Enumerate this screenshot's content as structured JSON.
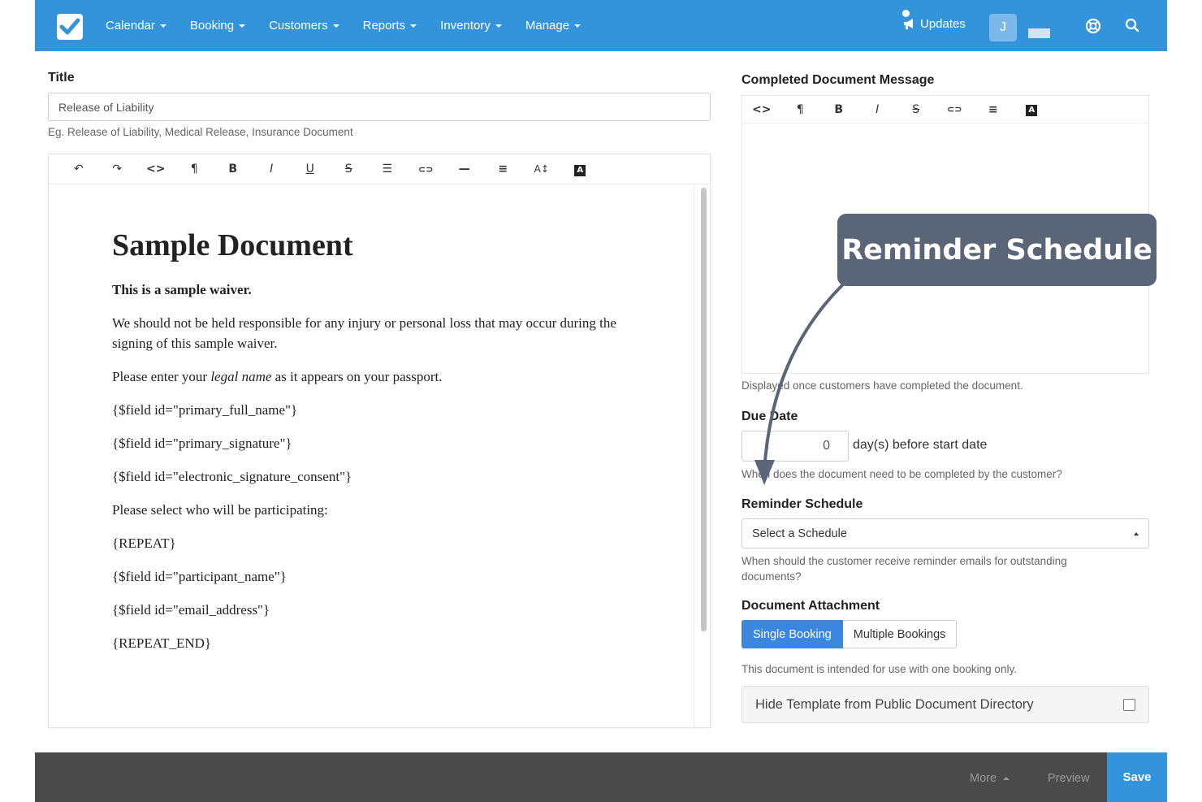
{
  "nav": {
    "items": [
      {
        "label": "Calendar"
      },
      {
        "label": "Booking"
      },
      {
        "label": "Customers"
      },
      {
        "label": "Reports"
      },
      {
        "label": "Inventory"
      },
      {
        "label": "Manage"
      }
    ],
    "updates_label": "Updates",
    "avatar_initial": "J"
  },
  "title_field": {
    "label": "Title",
    "value": "Release of Liability",
    "hint": "Eg. Release of Liability, Medical Release, Insurance Document"
  },
  "main_editor": {
    "toolbar_icons": [
      "undo-icon",
      "redo-icon",
      "code-view-icon",
      "paragraph-icon",
      "bold-icon",
      "italic-icon",
      "underline-icon",
      "strikethrough-icon",
      "list-icon",
      "link-icon",
      "horizontal-rule-icon",
      "align-icon",
      "font-size-icon",
      "text-color-icon"
    ],
    "toolbar_glyphs": {
      "undo": "↶",
      "redo": "↷",
      "code": "<>",
      "para": "¶",
      "bold": "B",
      "italic": "I",
      "underline": "U",
      "strike": "S",
      "list": "☰",
      "link": "⊂⊃",
      "hr": "—",
      "align": "≡",
      "fontsize": "A↕",
      "color": "A"
    },
    "heading": "Sample Document",
    "paragraphs": [
      {
        "text": "This is a sample waiver.",
        "bold": true
      },
      {
        "text": "We should not be held responsible for any injury or personal loss that may occur during the signing of this sample waiver."
      },
      {
        "text_before": "Please enter your ",
        "text_italic": "legal name",
        "text_after": " as it appears on your passport."
      },
      {
        "text": "{$field id=\"primary_full_name\"}"
      },
      {
        "text": "{$field id=\"primary_signature\"}"
      },
      {
        "text": "{$field id=\"electronic_signature_consent\"}"
      },
      {
        "text": "Please select who will be participating:"
      },
      {
        "text": "{REPEAT}"
      },
      {
        "text": "{$field id=\"participant_name\"}"
      },
      {
        "text": "{$field id=\"email_address\"}"
      },
      {
        "text": "{REPEAT_END}"
      }
    ]
  },
  "completed_message": {
    "label": "Completed Document Message",
    "toolbar_glyphs": {
      "code": "<>",
      "para": "¶",
      "bold": "B",
      "italic": "I",
      "strike": "S",
      "link": "⊂⊃",
      "align": "≡",
      "color": "A"
    },
    "hint": "Displayed once customers have completed the document."
  },
  "due_date": {
    "label": "Due Date",
    "value": "0",
    "suffix": "day(s) before start date",
    "hint": "When does the document need to be completed by the customer?"
  },
  "reminder": {
    "label": "Reminder Schedule",
    "selected": "Select a Schedule",
    "hint": "When should the customer receive reminder emails for outstanding documents?"
  },
  "attachment": {
    "label": "Document Attachment",
    "options": [
      "Single Booking",
      "Multiple Bookings"
    ],
    "selected": "Single Booking",
    "hint": "This document is intended for use with one booking only."
  },
  "hide_template": {
    "label": "Hide Template from Public Document Directory",
    "checked": false
  },
  "bottom": {
    "more": "More",
    "preview": "Preview",
    "save": "Save"
  },
  "callout": {
    "text": "Reminder Schedule"
  },
  "colors": {
    "nav_bg": "#3394dc",
    "accent": "#3b86df",
    "callout_bg": "#5a6577",
    "bottom_bg": "#4a4a4a"
  }
}
